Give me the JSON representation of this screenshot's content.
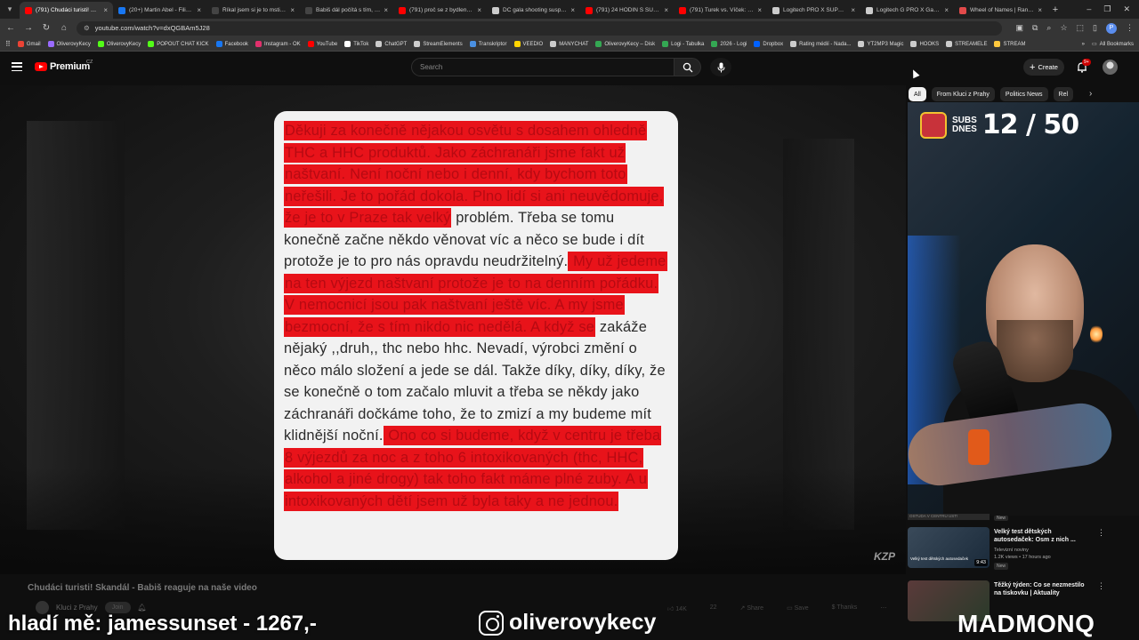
{
  "browser": {
    "tabs": [
      {
        "label": "(791) Chudáci turisti! Skan...",
        "color": "#ff0000",
        "active": true
      },
      {
        "label": "(20+) Martin Abel - Filip T...",
        "color": "#1877f2",
        "active": false
      },
      {
        "label": "Říkal jsem si je to mstivý...",
        "color": "#444444",
        "active": false
      },
      {
        "label": "Babiš dál počítá s tím, že...",
        "color": "#444444",
        "active": false
      },
      {
        "label": "(791) proč se z bydlení v...",
        "color": "#ff0000",
        "active": false
      },
      {
        "label": "DC gala shooting suspect...",
        "color": "#cccccc",
        "active": false
      },
      {
        "label": "(791) 24 HODIN S SUGAR...",
        "color": "#ff0000",
        "active": false
      },
      {
        "label": "(791) Turek vs. Víček: Vzta...",
        "color": "#ff0000",
        "active": false
      },
      {
        "label": "Logitech PRO X SUPERLIG...",
        "color": "#cccccc",
        "active": false
      },
      {
        "label": "Logitech G PRO X Gaming...",
        "color": "#cccccc",
        "active": false
      },
      {
        "label": "Wheel of Names | Random...",
        "color": "#e24a4a",
        "active": false
      }
    ],
    "url": "youtube.com/watch?v=dxQGBAm5J28",
    "bookmarks": [
      {
        "label": "Gmail",
        "color": "#ea4335"
      },
      {
        "label": "OliverovyKecy",
        "color": "#9a6bff"
      },
      {
        "label": "OliverovyKecy",
        "color": "#53fc18"
      },
      {
        "label": "POPOUT CHAT KICK",
        "color": "#53fc18"
      },
      {
        "label": "Facebook",
        "color": "#1877f2"
      },
      {
        "label": "Instagram - OK",
        "color": "#e1306c"
      },
      {
        "label": "YouTube",
        "color": "#ff0000"
      },
      {
        "label": "TikTok",
        "color": "#ffffff"
      },
      {
        "label": "ChatGPT",
        "color": "#cccccc"
      },
      {
        "label": "StreamElements",
        "color": "#cccccc"
      },
      {
        "label": "Transkriptor",
        "color": "#4a90e2"
      },
      {
        "label": "VEEDIO",
        "color": "#ffd400"
      },
      {
        "label": "MANYCHAT",
        "color": "#cccccc"
      },
      {
        "label": "OliverovyKecy – Disk",
        "color": "#34a853"
      },
      {
        "label": "Logi - Tabulka",
        "color": "#34a853"
      },
      {
        "label": "2026 - Logi",
        "color": "#34a853"
      },
      {
        "label": "Dropbox",
        "color": "#0061ff"
      },
      {
        "label": "Rating médií - Nada...",
        "color": "#cccccc"
      },
      {
        "label": "YT2MP3 Magic",
        "color": "#cccccc"
      },
      {
        "label": "HOOKS",
        "color": "#cccccc"
      },
      {
        "label": "STREAMELE",
        "color": "#cccccc"
      },
      {
        "label": "STREAM",
        "color": "#ffc83d"
      }
    ],
    "all_bookmarks": "All Bookmarks"
  },
  "header": {
    "logo_text": "Premium",
    "logo_region": "CZ",
    "search_placeholder": "Search",
    "create_label": "Create",
    "notifications_badge": "9+"
  },
  "video": {
    "note_segments": [
      {
        "text": "Děkuji za konečně nějakou osvětu s dosahem ohledně THC a HHC produktů. Jako záchranáři jsme fakt už naštvaní. Není noční nebo i denní, kdy bychom toto neřešili. Je to pořád dokola. Plno lidí si ani neuvědomuje, že je to v Praze tak velký",
        "hl": true
      },
      {
        "text": " problém. Třeba se tomu konečně začne někdo věnovat víc a něco se bude i dít protože je to pro nás opravdu neudržitelný.",
        "hl": false
      },
      {
        "text": " My už jedeme na ten výjezd naštvaní protože je to na denním pořádku. V nemocnicí jsou pak naštvaní ještě víc. A my jsme bezmocní, že s tím nikdo nic nedělá. A když se",
        "hl": true
      },
      {
        "text": " zakáže nějaký ,,druh,, thc nebo hhc. Nevadí, výrobci změní o něco málo složení a jede se dál. Takže díky, díky, díky, že se konečně o tom začalo mluvit a třeba se někdy jako záchranáři dočkáme toho, že to zmizí a my budeme mít klidnější noční.",
        "hl": false
      },
      {
        "text": " Ono co si budeme, když v centru je třeba 8 výjezdů za noc a z toho 6 intoxikovaných (thc, HHC, alkohol a jiné drogy) tak toho fakt máme plné zuby. A u intoxikovaných dětí jsem už byla taky a ne jednou.",
        "hl": true
      }
    ],
    "watermark": "KZP",
    "title": "Chudáci turisti! Skandál - Babiš reaguje na naše video",
    "channel": "Kluci z Prahy",
    "join_label": "Join",
    "likes": "14K",
    "comments": "22",
    "share_label": "Share",
    "save_label": "Save",
    "thanks_label": "Thanks"
  },
  "sidebar": {
    "chips": [
      {
        "label": "All",
        "active": true
      },
      {
        "label": "From Kluci z Prahy",
        "active": false
      },
      {
        "label": "Politics News",
        "active": false
      },
      {
        "label": "Rel",
        "active": false
      }
    ],
    "webcam_overlay": {
      "label_line1": "SUBS",
      "label_line2": "DNES",
      "count": "12 / 50"
    },
    "top_strip_caption": "OSTUDA V CENTRU UST!",
    "top_strip_badge": "New",
    "recommendations": [
      {
        "title": "Velký test dětských autosedaček: Osm z nich ...",
        "channel": "Televizní noviny",
        "meta": "1.2K views • 17 hours ago",
        "badge": "New",
        "duration": "9:43",
        "caption": "Velký test dětských autosedaček"
      },
      {
        "title": "Těžký týden: Co se nezmestilo na tiskovku | Aktuality",
        "channel": "",
        "meta": "",
        "badge": "",
        "duration": "",
        "caption": ""
      }
    ]
  },
  "overlay": {
    "left": "hladí mě: jamessunset - 1267,-",
    "instagram": "oliverovykecy",
    "right": "MADMONQ"
  }
}
